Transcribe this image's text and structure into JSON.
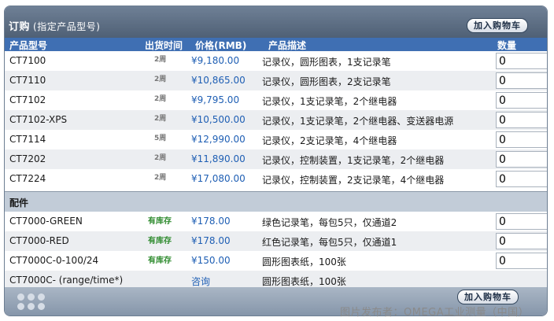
{
  "header": {
    "title": "订购",
    "subtitle": "(指定产品型号)",
    "add_to_cart": "加入购物车"
  },
  "columns": {
    "model": "产品型号",
    "ship": "出货时间",
    "price": "价格(RMB)",
    "desc": "产品描述",
    "qty": "数量"
  },
  "products": [
    {
      "model": "CT7100",
      "ship": "2周",
      "price": "¥9,180.00",
      "desc": "记录仪，圆形图表，1支记录笔",
      "qty": "0"
    },
    {
      "model": "CT7110",
      "ship": "2周",
      "price": "¥10,865.00",
      "desc": "记录仪，圆形图表，2支记录笔",
      "qty": "0"
    },
    {
      "model": "CT7102",
      "ship": "2周",
      "price": "¥9,795.00",
      "desc": "记录仪，1支记录笔，2个继电器",
      "qty": "0"
    },
    {
      "model": "CT7102-XPS",
      "ship": "2周",
      "price": "¥10,500.00",
      "desc": "记录仪，1支记录笔，2个继电器、变送器电源",
      "qty": "0"
    },
    {
      "model": "CT7114",
      "ship": "5周",
      "price": "¥12,990.00",
      "desc": "记录仪，2支记录笔，4个继电器",
      "qty": "0"
    },
    {
      "model": "CT7202",
      "ship": "2周",
      "price": "¥11,890.00",
      "desc": "记录仪，控制装置，1支记录笔，2个继电器",
      "qty": "0"
    },
    {
      "model": "CT7224",
      "ship": "2周",
      "price": "¥17,080.00",
      "desc": "记录仪，控制装置，2支记录笔，4个继电器",
      "qty": "0"
    }
  ],
  "accessories_title": "配件",
  "accessories": [
    {
      "model": "CT7000-GREEN",
      "ship": "有库存",
      "price": "¥178.00",
      "desc": "绿色记录笔，每包5只，仅通道2",
      "qty": "0"
    },
    {
      "model": "CT7000-RED",
      "ship": "有库存",
      "price": "¥178.00",
      "desc": "红色记录笔，每包5只，仅通道1",
      "qty": "0"
    },
    {
      "model": "CT7000C-0-100/24",
      "ship": "有库存",
      "price": "¥150.00",
      "desc": "圆形图表纸，100张",
      "qty": "0"
    },
    {
      "model": "CT7000C- (range/time*)",
      "ship": "",
      "price": "咨询",
      "desc": "圆形图表纸，100张"
    }
  ],
  "footer": {
    "add_to_cart": "加入购物车",
    "watermark": "图片发布者：OMEGA工业测量（中国）"
  }
}
